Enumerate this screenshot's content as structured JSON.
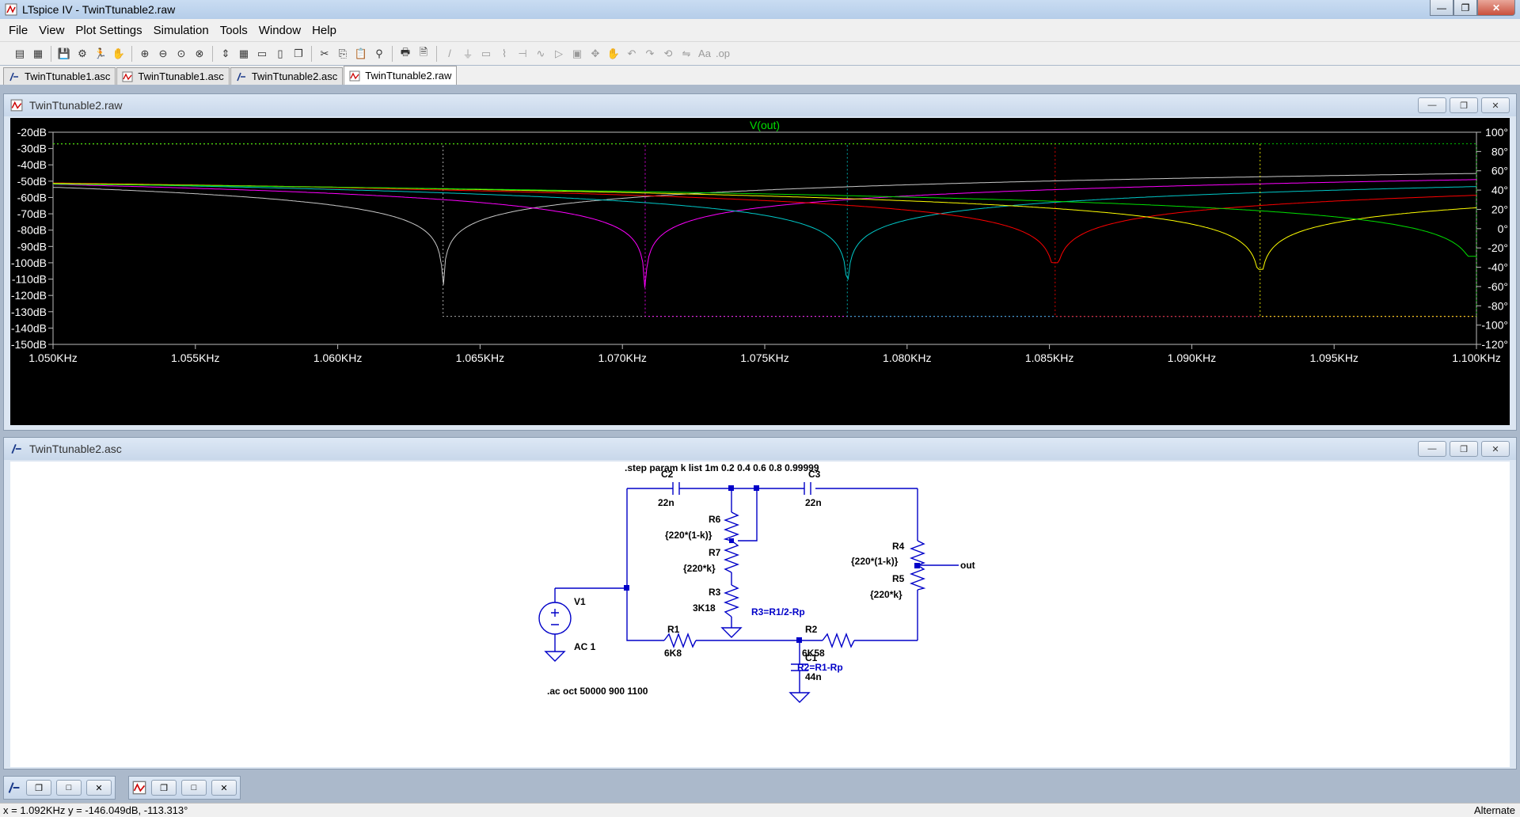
{
  "window": {
    "title": "LTspice IV - TwinTtunable2.raw"
  },
  "menu": [
    "File",
    "View",
    "Plot Settings",
    "Simulation",
    "Tools",
    "Window",
    "Help"
  ],
  "toolbar_icons": [
    "new-schematic-icon",
    "open-icon",
    "save-icon",
    "control-panel-icon",
    "run-icon",
    "halt-icon",
    "zoom-in-icon",
    "zoom-out-icon",
    "zoom-fit-icon",
    "zoom-cancel-icon",
    "autorange-icon",
    "grid-icon",
    "tile-horizontal-icon",
    "tile-vertical-icon",
    "cascade-icon",
    "cut-icon",
    "copy-icon",
    "paste-icon",
    "find-icon",
    "print-icon",
    "print-preview-icon",
    "wire-icon",
    "ground-icon",
    "label-icon",
    "resistor-icon",
    "capacitor-icon",
    "inductor-icon",
    "diode-icon",
    "component-icon",
    "move-icon",
    "drag-icon",
    "undo-icon",
    "redo-icon",
    "rotate-icon",
    "mirror-icon",
    "text-icon",
    "spice-directive-icon"
  ],
  "tabs": [
    {
      "label": "TwinTtunable1.asc",
      "icon": "schematic-icon",
      "active": false
    },
    {
      "label": "TwinTtunable1.asc",
      "icon": "waveform-icon",
      "active": false
    },
    {
      "label": "TwinTtunable2.asc",
      "icon": "schematic-icon",
      "active": false
    },
    {
      "label": "TwinTtunable2.raw",
      "icon": "waveform-icon",
      "active": true
    }
  ],
  "plot": {
    "title": "TwinTtunable2.raw",
    "trace_label": "V(out)",
    "trace_color": "#00ff00"
  },
  "chart_data": {
    "type": "line",
    "title": "V(out)",
    "xlabel": "",
    "ylabel": "",
    "x_ticks": [
      "1.050KHz",
      "1.055KHz",
      "1.060KHz",
      "1.065KHz",
      "1.070KHz",
      "1.075KHz",
      "1.080KHz",
      "1.085KHz",
      "1.090KHz",
      "1.095KHz",
      "1.100KHz"
    ],
    "y_left_ticks": [
      "-20dB",
      "-30dB",
      "-40dB",
      "-50dB",
      "-60dB",
      "-70dB",
      "-80dB",
      "-90dB",
      "-100dB",
      "-110dB",
      "-120dB",
      "-130dB",
      "-140dB",
      "-150dB"
    ],
    "y_right_ticks": [
      "100°",
      "80°",
      "60°",
      "40°",
      "20°",
      "0°",
      "-20°",
      "-40°",
      "-60°",
      "-80°",
      "-100°",
      "-120°"
    ],
    "xlim_khz": [
      1.05,
      1.1
    ],
    "ylim_db": [
      -150,
      -20
    ],
    "phase_lim_deg": [
      -120,
      100
    ],
    "series": [
      {
        "color": "#c8c8c8",
        "notch_khz": 1.0637,
        "notch_db": -120,
        "phase_high": 88,
        "phase_low": -91
      },
      {
        "color": "#ff00ff",
        "notch_khz": 1.0708,
        "notch_db": -122,
        "phase_high": 88,
        "phase_low": -91
      },
      {
        "color": "#00c8c8",
        "notch_khz": 1.0779,
        "notch_db": -110,
        "phase_high": 88,
        "phase_low": -91
      },
      {
        "color": "#ff0000",
        "notch_khz": 1.0852,
        "notch_db": -100,
        "phase_high": 88,
        "phase_low": -91
      },
      {
        "color": "#ffff00",
        "notch_khz": 1.0924,
        "notch_db": -104,
        "phase_high": 88,
        "phase_low": -91
      },
      {
        "color": "#00e000",
        "notch_khz": 1.1,
        "notch_db": -96,
        "phase_high": 88,
        "phase_low": -91
      }
    ]
  },
  "schematic": {
    "title": "TwinTtunable2.asc",
    "step_directive": ".step param k list 1m 0.2 0.4 0.6 0.8 0.99999",
    "ac_directive": ".ac oct 50000 900 1100",
    "components": {
      "C2": {
        "name": "C2",
        "value": "22n"
      },
      "C3": {
        "name": "C3",
        "value": "22n"
      },
      "R6": {
        "name": "R6",
        "value": "{220*(1-k)}"
      },
      "R7": {
        "name": "R7",
        "value": "{220*k}"
      },
      "R3": {
        "name": "R3",
        "value": "3K18",
        "note": "R3=R1/2-Rp"
      },
      "R4": {
        "name": "R4",
        "value": "{220*(1-k)}"
      },
      "R5": {
        "name": "R5",
        "value": "{220*k}"
      },
      "V1": {
        "name": "V1",
        "value": "AC 1"
      },
      "R1": {
        "name": "R1",
        "value": "6K8"
      },
      "R2": {
        "name": "R2",
        "value": "6K58",
        "note": "R2=R1-Rp"
      },
      "C1": {
        "name": "C1",
        "value": "44n"
      }
    },
    "out_label": "out"
  },
  "status": {
    "cursor": "x = 1.092KHz    y = -146.049dB, -113.313°",
    "mode": "Alternate"
  }
}
